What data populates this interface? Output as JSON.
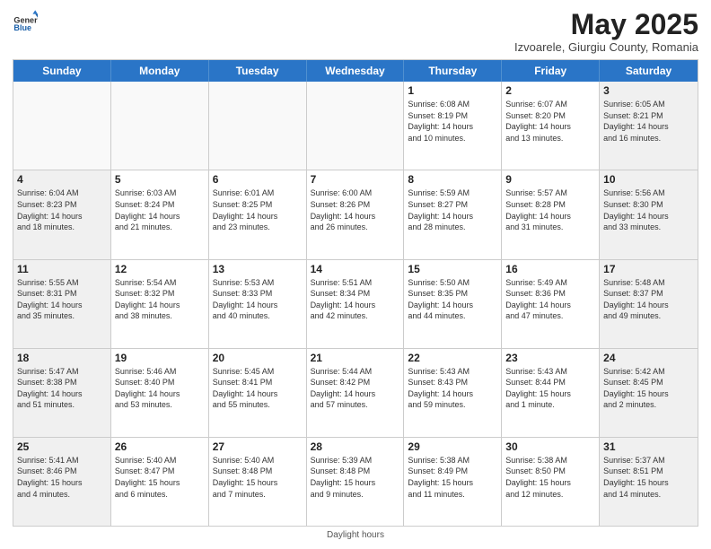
{
  "header": {
    "logo": {
      "general": "General",
      "blue": "Blue"
    },
    "title": "May 2025",
    "subtitle": "Izvoarele, Giurgiu County, Romania"
  },
  "days_of_week": [
    "Sunday",
    "Monday",
    "Tuesday",
    "Wednesday",
    "Thursday",
    "Friday",
    "Saturday"
  ],
  "weeks": [
    [
      {
        "day": "",
        "info": "",
        "empty": true
      },
      {
        "day": "",
        "info": "",
        "empty": true
      },
      {
        "day": "",
        "info": "",
        "empty": true
      },
      {
        "day": "",
        "info": "",
        "empty": true
      },
      {
        "day": "1",
        "info": "Sunrise: 6:08 AM\nSunset: 8:19 PM\nDaylight: 14 hours\nand 10 minutes.",
        "empty": false
      },
      {
        "day": "2",
        "info": "Sunrise: 6:07 AM\nSunset: 8:20 PM\nDaylight: 14 hours\nand 13 minutes.",
        "empty": false
      },
      {
        "day": "3",
        "info": "Sunrise: 6:05 AM\nSunset: 8:21 PM\nDaylight: 14 hours\nand 16 minutes.",
        "empty": false
      }
    ],
    [
      {
        "day": "4",
        "info": "Sunrise: 6:04 AM\nSunset: 8:23 PM\nDaylight: 14 hours\nand 18 minutes.",
        "empty": false
      },
      {
        "day": "5",
        "info": "Sunrise: 6:03 AM\nSunset: 8:24 PM\nDaylight: 14 hours\nand 21 minutes.",
        "empty": false
      },
      {
        "day": "6",
        "info": "Sunrise: 6:01 AM\nSunset: 8:25 PM\nDaylight: 14 hours\nand 23 minutes.",
        "empty": false
      },
      {
        "day": "7",
        "info": "Sunrise: 6:00 AM\nSunset: 8:26 PM\nDaylight: 14 hours\nand 26 minutes.",
        "empty": false
      },
      {
        "day": "8",
        "info": "Sunrise: 5:59 AM\nSunset: 8:27 PM\nDaylight: 14 hours\nand 28 minutes.",
        "empty": false
      },
      {
        "day": "9",
        "info": "Sunrise: 5:57 AM\nSunset: 8:28 PM\nDaylight: 14 hours\nand 31 minutes.",
        "empty": false
      },
      {
        "day": "10",
        "info": "Sunrise: 5:56 AM\nSunset: 8:30 PM\nDaylight: 14 hours\nand 33 minutes.",
        "empty": false
      }
    ],
    [
      {
        "day": "11",
        "info": "Sunrise: 5:55 AM\nSunset: 8:31 PM\nDaylight: 14 hours\nand 35 minutes.",
        "empty": false
      },
      {
        "day": "12",
        "info": "Sunrise: 5:54 AM\nSunset: 8:32 PM\nDaylight: 14 hours\nand 38 minutes.",
        "empty": false
      },
      {
        "day": "13",
        "info": "Sunrise: 5:53 AM\nSunset: 8:33 PM\nDaylight: 14 hours\nand 40 minutes.",
        "empty": false
      },
      {
        "day": "14",
        "info": "Sunrise: 5:51 AM\nSunset: 8:34 PM\nDaylight: 14 hours\nand 42 minutes.",
        "empty": false
      },
      {
        "day": "15",
        "info": "Sunrise: 5:50 AM\nSunset: 8:35 PM\nDaylight: 14 hours\nand 44 minutes.",
        "empty": false
      },
      {
        "day": "16",
        "info": "Sunrise: 5:49 AM\nSunset: 8:36 PM\nDaylight: 14 hours\nand 47 minutes.",
        "empty": false
      },
      {
        "day": "17",
        "info": "Sunrise: 5:48 AM\nSunset: 8:37 PM\nDaylight: 14 hours\nand 49 minutes.",
        "empty": false
      }
    ],
    [
      {
        "day": "18",
        "info": "Sunrise: 5:47 AM\nSunset: 8:38 PM\nDaylight: 14 hours\nand 51 minutes.",
        "empty": false
      },
      {
        "day": "19",
        "info": "Sunrise: 5:46 AM\nSunset: 8:40 PM\nDaylight: 14 hours\nand 53 minutes.",
        "empty": false
      },
      {
        "day": "20",
        "info": "Sunrise: 5:45 AM\nSunset: 8:41 PM\nDaylight: 14 hours\nand 55 minutes.",
        "empty": false
      },
      {
        "day": "21",
        "info": "Sunrise: 5:44 AM\nSunset: 8:42 PM\nDaylight: 14 hours\nand 57 minutes.",
        "empty": false
      },
      {
        "day": "22",
        "info": "Sunrise: 5:43 AM\nSunset: 8:43 PM\nDaylight: 14 hours\nand 59 minutes.",
        "empty": false
      },
      {
        "day": "23",
        "info": "Sunrise: 5:43 AM\nSunset: 8:44 PM\nDaylight: 15 hours\nand 1 minute.",
        "empty": false
      },
      {
        "day": "24",
        "info": "Sunrise: 5:42 AM\nSunset: 8:45 PM\nDaylight: 15 hours\nand 2 minutes.",
        "empty": false
      }
    ],
    [
      {
        "day": "25",
        "info": "Sunrise: 5:41 AM\nSunset: 8:46 PM\nDaylight: 15 hours\nand 4 minutes.",
        "empty": false
      },
      {
        "day": "26",
        "info": "Sunrise: 5:40 AM\nSunset: 8:47 PM\nDaylight: 15 hours\nand 6 minutes.",
        "empty": false
      },
      {
        "day": "27",
        "info": "Sunrise: 5:40 AM\nSunset: 8:48 PM\nDaylight: 15 hours\nand 7 minutes.",
        "empty": false
      },
      {
        "day": "28",
        "info": "Sunrise: 5:39 AM\nSunset: 8:48 PM\nDaylight: 15 hours\nand 9 minutes.",
        "empty": false
      },
      {
        "day": "29",
        "info": "Sunrise: 5:38 AM\nSunset: 8:49 PM\nDaylight: 15 hours\nand 11 minutes.",
        "empty": false
      },
      {
        "day": "30",
        "info": "Sunrise: 5:38 AM\nSunset: 8:50 PM\nDaylight: 15 hours\nand 12 minutes.",
        "empty": false
      },
      {
        "day": "31",
        "info": "Sunrise: 5:37 AM\nSunset: 8:51 PM\nDaylight: 15 hours\nand 14 minutes.",
        "empty": false
      }
    ]
  ],
  "footer": {
    "daylight_label": "Daylight hours"
  }
}
